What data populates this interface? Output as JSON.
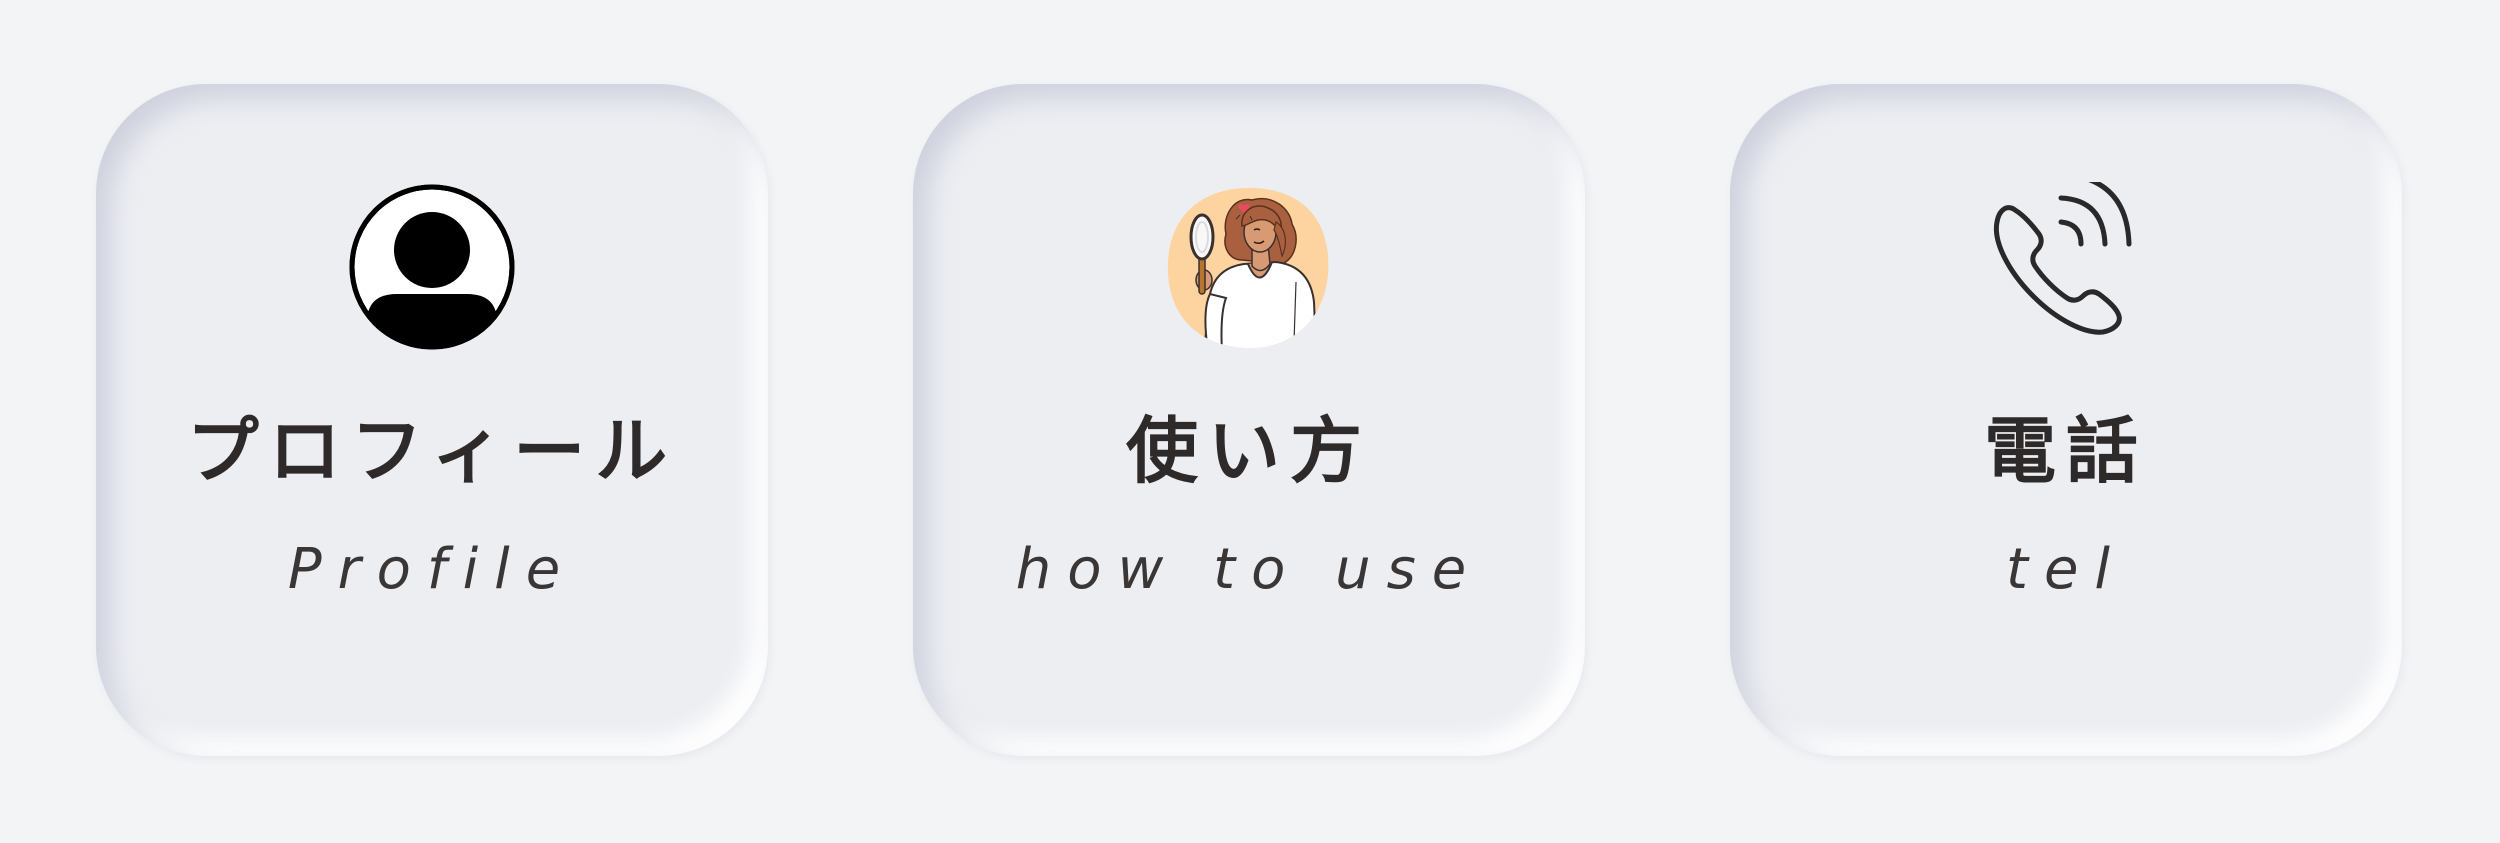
{
  "cards": [
    {
      "id": "profile",
      "title_ja": "プロフィール",
      "title_en": "Profile",
      "icon": "user-circle-icon"
    },
    {
      "id": "howto",
      "title_ja": "使い方",
      "title_en": "how to use",
      "icon": "woman-with-magnifier-illustration"
    },
    {
      "id": "tel",
      "title_ja": "電話",
      "title_en": "tel",
      "icon": "phone-ringing-icon"
    }
  ],
  "colors": {
    "background": "#f3f4f6",
    "card": "#eceef2",
    "text": "#2e2a2a",
    "illustration_blob": "#fdd39f",
    "illustration_hair": "#a9603f",
    "illustration_heart": "#e84a5f"
  }
}
